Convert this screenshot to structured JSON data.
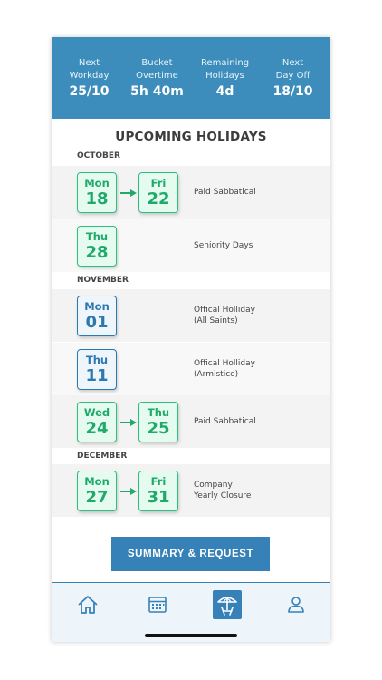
{
  "header": {
    "stats": [
      {
        "label1": "Next",
        "label2": "Workday",
        "value": "25/10"
      },
      {
        "label1": "Bucket",
        "label2": "Overtime",
        "value": "5h 40m"
      },
      {
        "label1": "Remaining",
        "label2": "Holidays",
        "value": "4d"
      },
      {
        "label1": "Next",
        "label2": "Day Off",
        "value": "18/10"
      }
    ]
  },
  "title": "UPCOMING HOLIDAYS",
  "months": {
    "october": "OCTOBER",
    "november": "NOVEMBER",
    "december": "DECEMBER"
  },
  "holidays": [
    {
      "start": {
        "dow": "Mon",
        "day": "18"
      },
      "end": {
        "dow": "Fri",
        "day": "22"
      },
      "line1": "Paid Sabbatical",
      "line2": ""
    },
    {
      "start": {
        "dow": "Thu",
        "day": "28"
      },
      "line1": "Seniority Days",
      "line2": ""
    },
    {
      "start": {
        "dow": "Mon",
        "day": "01"
      },
      "line1": "Offical Holliday",
      "line2": "(All Saints)"
    },
    {
      "start": {
        "dow": "Thu",
        "day": "11"
      },
      "line1": "Offical Holliday",
      "line2": "(Armistice)"
    },
    {
      "start": {
        "dow": "Wed",
        "day": "24"
      },
      "end": {
        "dow": "Thu",
        "day": "25"
      },
      "line1": "Paid Sabbatical",
      "line2": ""
    },
    {
      "start": {
        "dow": "Mon",
        "day": "27"
      },
      "end": {
        "dow": "Fri",
        "day": "31"
      },
      "line1": "Company",
      "line2": "Yearly Closure"
    }
  ],
  "cta": {
    "label": "SUMMARY & REQUEST"
  },
  "colors": {
    "header": "#3c8dbc",
    "accent_green": "#1faa6a",
    "accent_blue": "#2e78b0",
    "button": "#3682b8"
  },
  "nav": {
    "items": [
      "home-icon",
      "calendar-icon",
      "beach-umbrella-icon",
      "user-icon"
    ],
    "active": "beach-umbrella-icon"
  }
}
